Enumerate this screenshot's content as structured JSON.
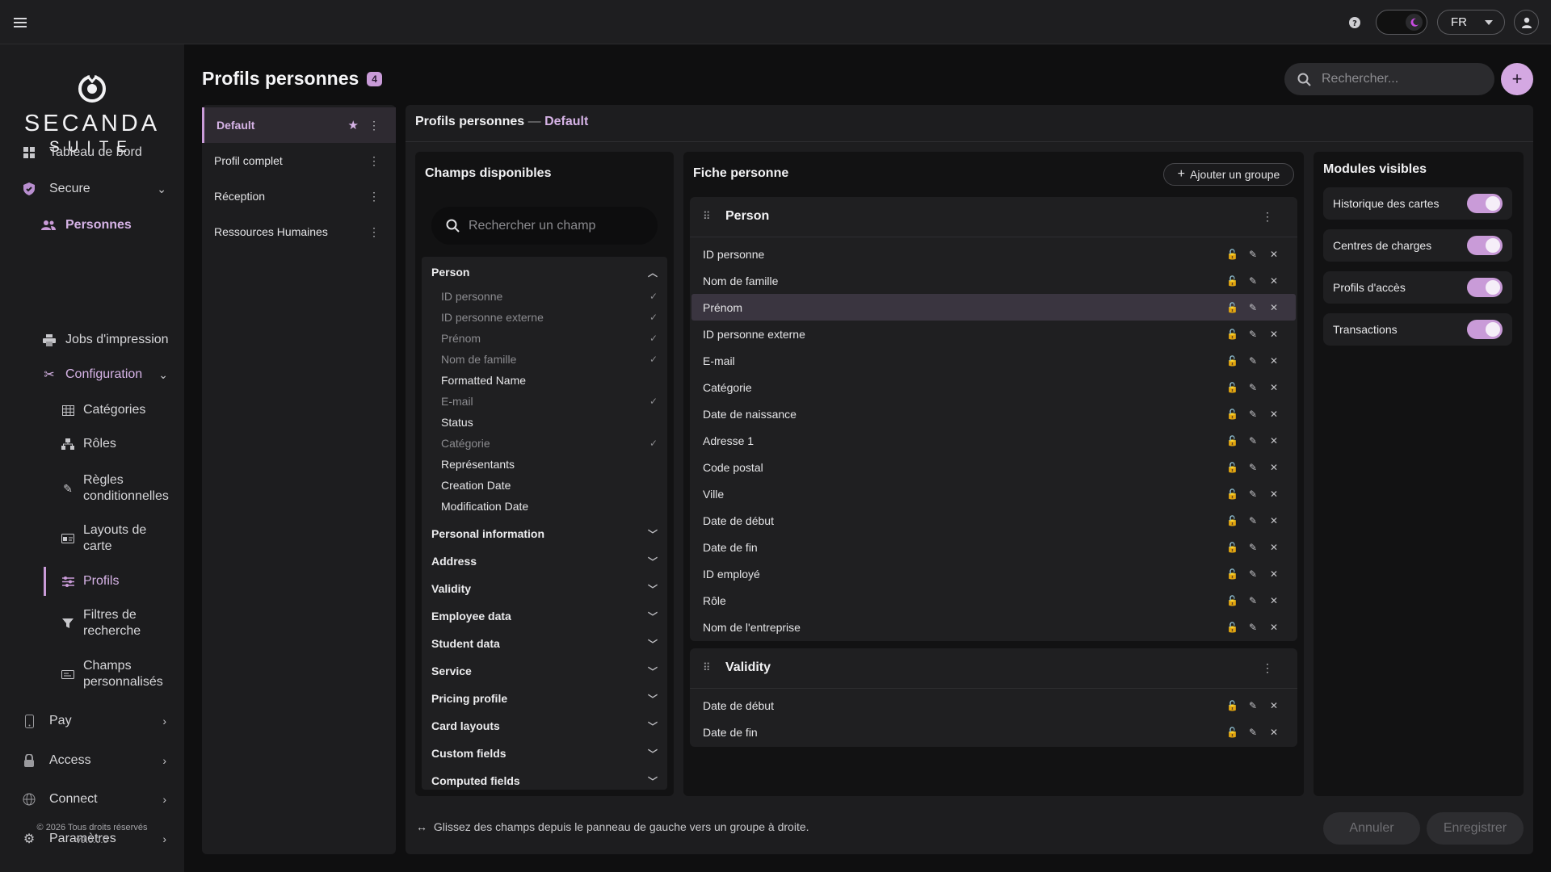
{
  "topbar": {
    "menu_icon": "hamburger-icon",
    "help_icon": "help-icon",
    "theme_icon": "moon-icon",
    "language": "FR",
    "user_icon": "user-icon"
  },
  "brand": {
    "name": "SECANDA",
    "sub": "SUITE"
  },
  "sidebar": {
    "items": [
      {
        "label": "Tableau de bord",
        "icon": "dashboard-icon"
      },
      {
        "label": "Secure",
        "icon": "shield-icon"
      },
      {
        "label": "Personnes",
        "icon": "people-icon"
      },
      {
        "label": "Jobs d'impression",
        "icon": "printer-icon"
      },
      {
        "label": "Configuration",
        "icon": "tools-icon"
      },
      {
        "label": "Catégories",
        "icon": "table-icon"
      },
      {
        "label": "Rôles",
        "icon": "hierarchy-icon"
      },
      {
        "label": "Règles conditionnelles",
        "icon": "magic-wand-icon"
      },
      {
        "label": "Layouts de carte",
        "icon": "id-card-icon"
      },
      {
        "label": "Profils",
        "icon": "sliders-icon"
      },
      {
        "label": "Filtres de recherche",
        "icon": "filter-icon"
      },
      {
        "label": "Champs personnalisés",
        "icon": "custom-field-icon"
      },
      {
        "label": "Pay",
        "icon": "phone-icon"
      },
      {
        "label": "Access",
        "icon": "lock-icon"
      },
      {
        "label": "Connect",
        "icon": "network-icon"
      },
      {
        "label": "Paramètres",
        "icon": "gear-icon"
      }
    ],
    "footer_copyright": "© 2026 Tous droits réservés",
    "footer_version": "v9.0.0.0"
  },
  "header": {
    "title": "Profils personnes",
    "count": "4",
    "search_placeholder": "Rechercher..."
  },
  "profiles": [
    {
      "label": "Default",
      "favorite": true
    },
    {
      "label": "Profil complet"
    },
    {
      "label": "Réception"
    },
    {
      "label": "Ressources Humaines"
    }
  ],
  "breadcrumb": {
    "root": "Profils personnes",
    "separator": "—",
    "current": "Default"
  },
  "available": {
    "title": "Champs disponibles",
    "search_placeholder": "Rechercher un champ",
    "person_group": "Person",
    "fields": [
      {
        "label": "ID personne",
        "used": true
      },
      {
        "label": "ID personne externe",
        "used": true
      },
      {
        "label": "Prénom",
        "used": true
      },
      {
        "label": "Nom de famille",
        "used": true
      },
      {
        "label": "Formatted Name",
        "used": false
      },
      {
        "label": "E-mail",
        "used": true
      },
      {
        "label": "Status",
        "used": false
      },
      {
        "label": "Catégorie",
        "used": true
      },
      {
        "label": "Représentants",
        "used": false
      },
      {
        "label": "Creation Date",
        "used": false
      },
      {
        "label": "Modification Date",
        "used": false
      }
    ],
    "groups": [
      "Personal information",
      "Address",
      "Validity",
      "Employee data",
      "Student data",
      "Service",
      "Pricing profile",
      "Card layouts",
      "Custom fields",
      "Computed fields"
    ]
  },
  "sheet": {
    "title": "Fiche personne",
    "add_group": "Ajouter un groupe",
    "groups": [
      {
        "name": "Person",
        "rows": [
          "ID personne",
          "Nom de famille",
          "Prénom",
          "ID personne externe",
          "E-mail",
          "Catégorie",
          "Date de naissance",
          "Adresse 1",
          "Code postal",
          "Ville",
          "Date de début",
          "Date de fin",
          "ID employé",
          "Rôle",
          "Nom de l'entreprise"
        ]
      },
      {
        "name": "Validity",
        "rows": [
          "Date de début",
          "Date de fin"
        ]
      }
    ],
    "highlighted_row": "Prénom"
  },
  "modules": {
    "title": "Modules visibles",
    "items": [
      {
        "label": "Historique des cartes",
        "on": true
      },
      {
        "label": "Centres de charges",
        "on": true
      },
      {
        "label": "Profils d'accès",
        "on": true
      },
      {
        "label": "Transactions",
        "on": true
      }
    ]
  },
  "footer": {
    "hint": "Glissez des champs depuis le panneau de gauche vers un groupe à droite.",
    "cancel": "Annuler",
    "save": "Enregistrer"
  },
  "colors": {
    "accent": "#c99bd8",
    "background": "#0f0f10",
    "panel": "#1d1d1f"
  }
}
